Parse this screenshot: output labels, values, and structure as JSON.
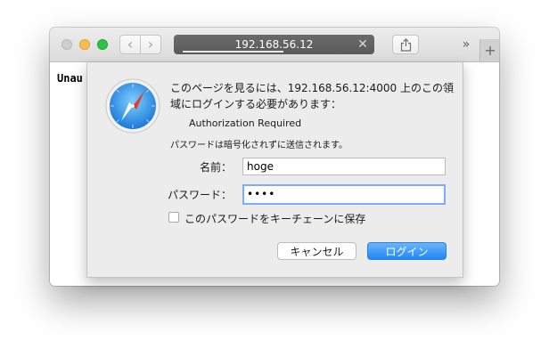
{
  "browser": {
    "address": "192.168.56.12",
    "back_glyph": "‹",
    "forward_glyph": "›",
    "stop_glyph": "✕",
    "overflow_glyph": "»",
    "newtab_glyph": "+",
    "load_progress_percent": 55
  },
  "page": {
    "body_text": "Unau"
  },
  "dialog": {
    "icon": "safari-compass-icon",
    "message": "このページを見るには、192.168.56.12:4000 上のこの領域にログインする必要があります：",
    "realm": "Authorization Required",
    "note": "パスワードは暗号化されずに送信されます。",
    "name_label": "名前：",
    "name_value": "hoge",
    "password_label": "パスワード：",
    "password_masked": "••••",
    "remember_label": "このパスワードをキーチェーンに保存",
    "remember_checked": false,
    "cancel_label": "キャンセル",
    "login_label": "ログイン"
  },
  "colors": {
    "primary_button": "#1f87f5",
    "focus_ring": "#7aaef5",
    "traffic_yellow": "#f5bf4f",
    "traffic_green": "#2dc248"
  }
}
